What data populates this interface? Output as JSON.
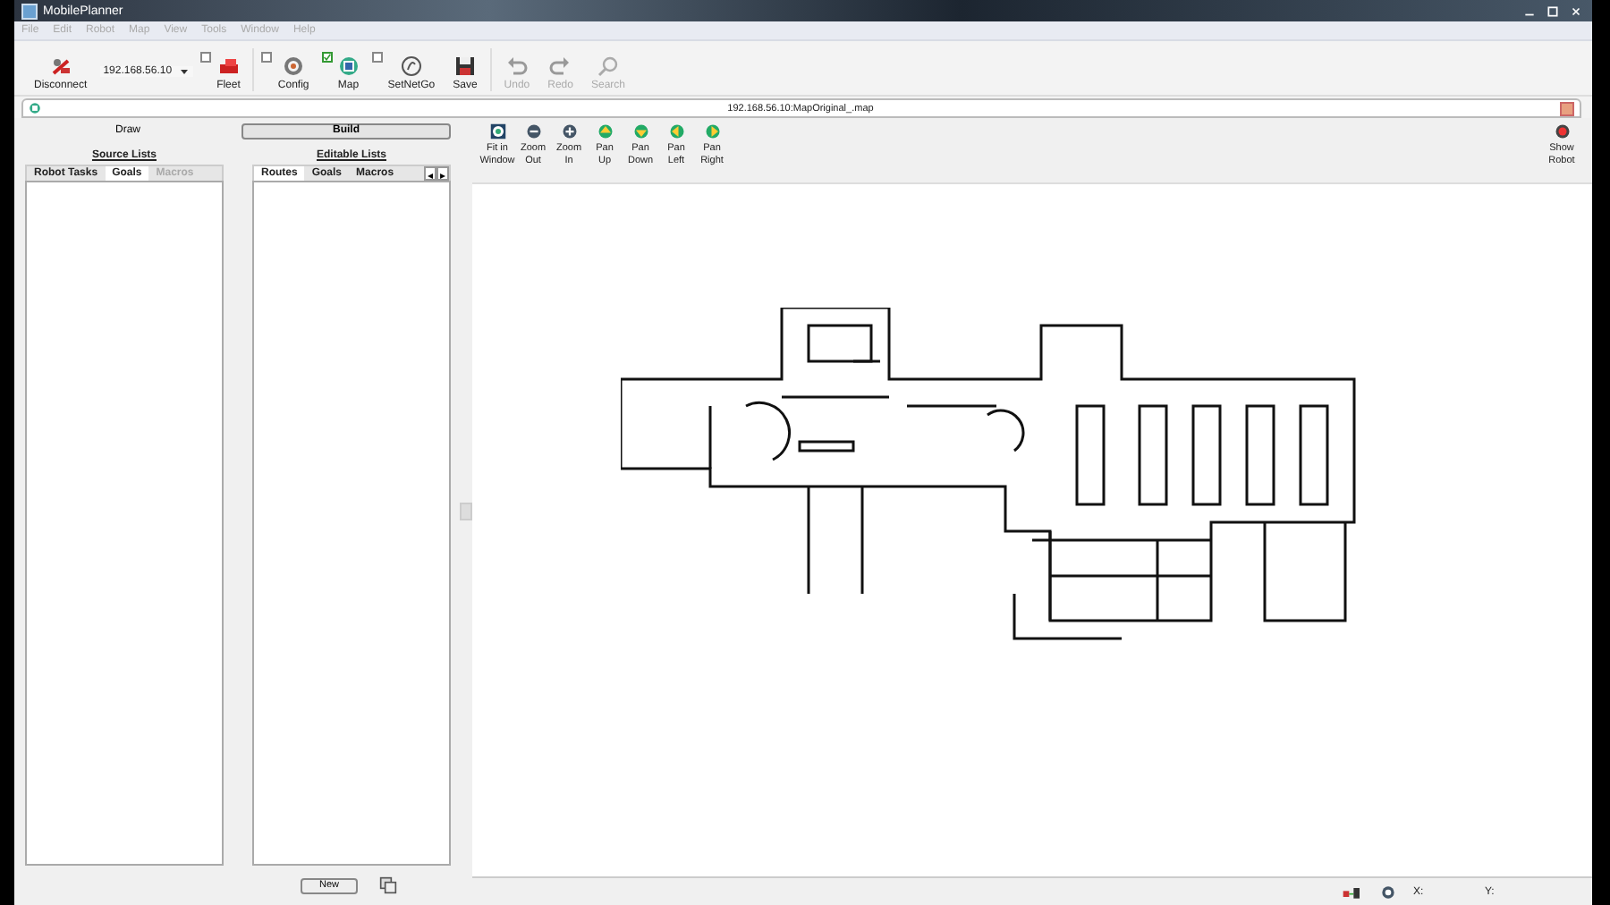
{
  "window": {
    "title": "MobilePlanner"
  },
  "menu": [
    "File",
    "Edit",
    "Robot",
    "Map",
    "View",
    "Tools",
    "Window",
    "Help"
  ],
  "toolbar": [
    {
      "kind": "button",
      "label": "Disconnect",
      "disabled": false
    },
    {
      "kind": "combo",
      "value": "192.168.56.10"
    },
    {
      "kind": "check",
      "label": "Fleet",
      "checked": false,
      "disabled": false
    },
    {
      "kind": "check",
      "label": "Config",
      "checked": false,
      "disabled": false
    },
    {
      "kind": "check",
      "label": "Map",
      "checked": true,
      "disabled": false
    },
    {
      "kind": "check",
      "label": "SetNetGo",
      "checked": false,
      "disabled": false
    },
    {
      "kind": "button",
      "label": "Save",
      "disabled": false
    },
    {
      "kind": "button",
      "label": "Undo",
      "disabled": true
    },
    {
      "kind": "button",
      "label": "Redo",
      "disabled": true
    },
    {
      "kind": "button",
      "label": "Search",
      "disabled": true
    }
  ],
  "document_tab": {
    "title": "192.168.56.10:MapOriginal_.map"
  },
  "mode_tabs": [
    {
      "label": "Draw",
      "selected": false
    },
    {
      "label": "Build",
      "selected": true
    }
  ],
  "source_lists": {
    "heading": "Source Lists",
    "tabs": [
      {
        "label": "Robot Tasks",
        "selected": false,
        "disabled": false
      },
      {
        "label": "Goals",
        "selected": true,
        "disabled": false
      },
      {
        "label": "Macros",
        "selected": false,
        "disabled": true
      }
    ]
  },
  "editable_lists": {
    "heading": "Editable Lists",
    "tabs": [
      {
        "label": "Routes",
        "selected": true
      },
      {
        "label": "Goals",
        "selected": false
      },
      {
        "label": "Macros",
        "selected": false
      }
    ],
    "scroll_arrows": [
      "◂",
      "▸"
    ],
    "new_button": "New"
  },
  "map_toolbar": [
    {
      "label": "Fit in Window"
    },
    {
      "label": "Zoom Out"
    },
    {
      "label": "Zoom In"
    },
    {
      "label": "Pan Up"
    },
    {
      "label": "Pan Down"
    },
    {
      "label": "Pan Left"
    },
    {
      "label": "Pan Right"
    }
  ],
  "show_robot": {
    "label": "Show Robot"
  },
  "status_bar": {
    "x_label": "X:",
    "y_label": "Y:"
  }
}
